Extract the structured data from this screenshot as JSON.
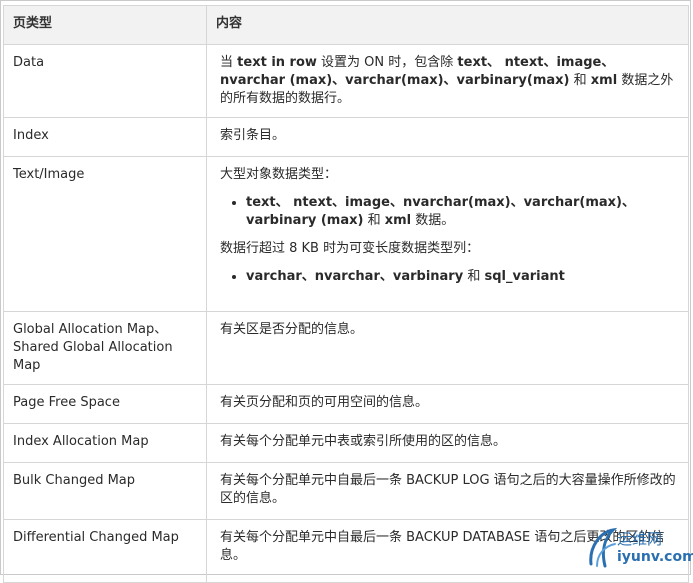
{
  "table": {
    "headers": [
      "页类型",
      "内容"
    ],
    "rows": {
      "data": {
        "type": "Data",
        "p1": "当",
        "p2": "text in row",
        "p3": "设置为 ON 时，包含除",
        "p4": "text、 ntext、image、nvarchar (max)、varchar(max)、varbinary(max)",
        "p5": "和",
        "p6": "xml",
        "p7": "数据之外的所有数据的数据行。"
      },
      "index": {
        "type": "Index",
        "content": "索引条目。"
      },
      "text_image": {
        "type": "Text/Image",
        "intro": "大型对象数据类型：",
        "bullet1_a": "text、 ntext、image、nvarchar(max)、varchar(max)、varbinary (max)",
        "bullet1_b": "和",
        "bullet1_c": "xml",
        "bullet1_d": "数据。",
        "mid": "数据行超过 8 KB 时为可变长度数据类型列：",
        "bullet2_a": "varchar、nvarchar、varbinary",
        "bullet2_b": "和",
        "bullet2_c": "sql_variant"
      },
      "gam": {
        "type_line1": "Global Allocation Map、",
        "type_line2": "Shared Global Allocation Map",
        "content": "有关区是否分配的信息。"
      },
      "pfs": {
        "type": "Page Free Space",
        "content": "有关页分配和页的可用空间的信息。"
      },
      "iam": {
        "type": "Index Allocation Map",
        "content": "有关每个分配单元中表或索引所使用的区的信息。"
      },
      "bcm": {
        "type": "Bulk Changed Map",
        "content": "有关每个分配单元中自最后一条 BACKUP LOG 语句之后的大容量操作所修改的区的信息。"
      },
      "dcm": {
        "type": "Differential Changed Map",
        "content": "有关每个分配单元中自最后一条 BACKUP DATABASE 语句之后更改的区的信息。"
      }
    }
  },
  "watermark": {
    "name": "运维网",
    "url": "iyunv.com",
    "accent": "#2a6fb0"
  }
}
